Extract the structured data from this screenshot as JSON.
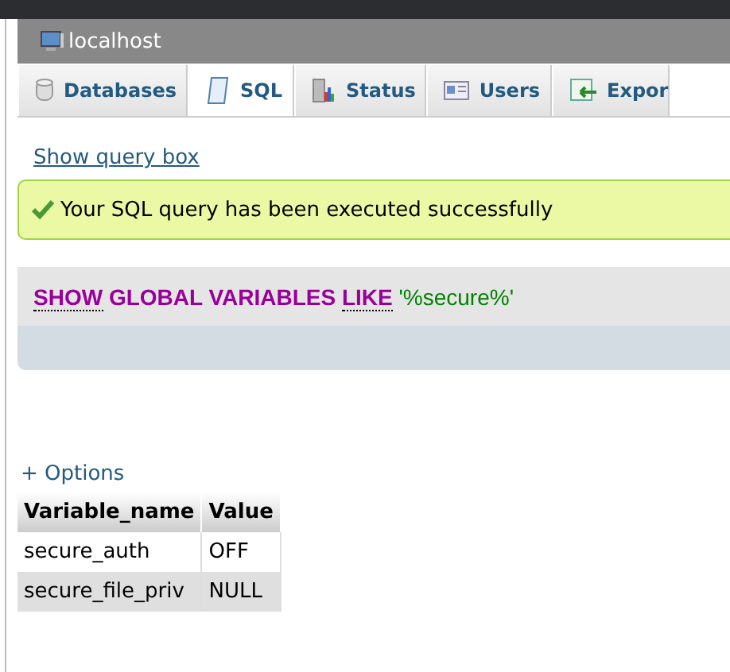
{
  "server": {
    "title": "localhost"
  },
  "tabs": [
    {
      "label": "Databases",
      "kind": "database",
      "selected": false
    },
    {
      "label": "SQL",
      "kind": "sql",
      "selected": true
    },
    {
      "label": "Status",
      "kind": "status",
      "selected": false
    },
    {
      "label": "Users",
      "kind": "users",
      "selected": false
    },
    {
      "label": "Expor",
      "kind": "export",
      "selected": false
    }
  ],
  "query_link": "Show query box",
  "message": "Your SQL query has been executed successfully",
  "sql": [
    {
      "text": "SHOW",
      "kind": "keyword",
      "documented": true
    },
    {
      "text": "GLOBAL VARIABLES",
      "kind": "keyword",
      "documented": false
    },
    {
      "text": "LIKE",
      "kind": "keyword",
      "documented": true
    },
    {
      "text": "'%secure%'",
      "kind": "string",
      "documented": false
    }
  ],
  "options_link": "+ Options",
  "table": {
    "columns": [
      "Variable_name",
      "Value"
    ],
    "rows": [
      [
        "secure_auth",
        "OFF"
      ],
      [
        "secure_file_priv",
        "NULL"
      ]
    ]
  }
}
